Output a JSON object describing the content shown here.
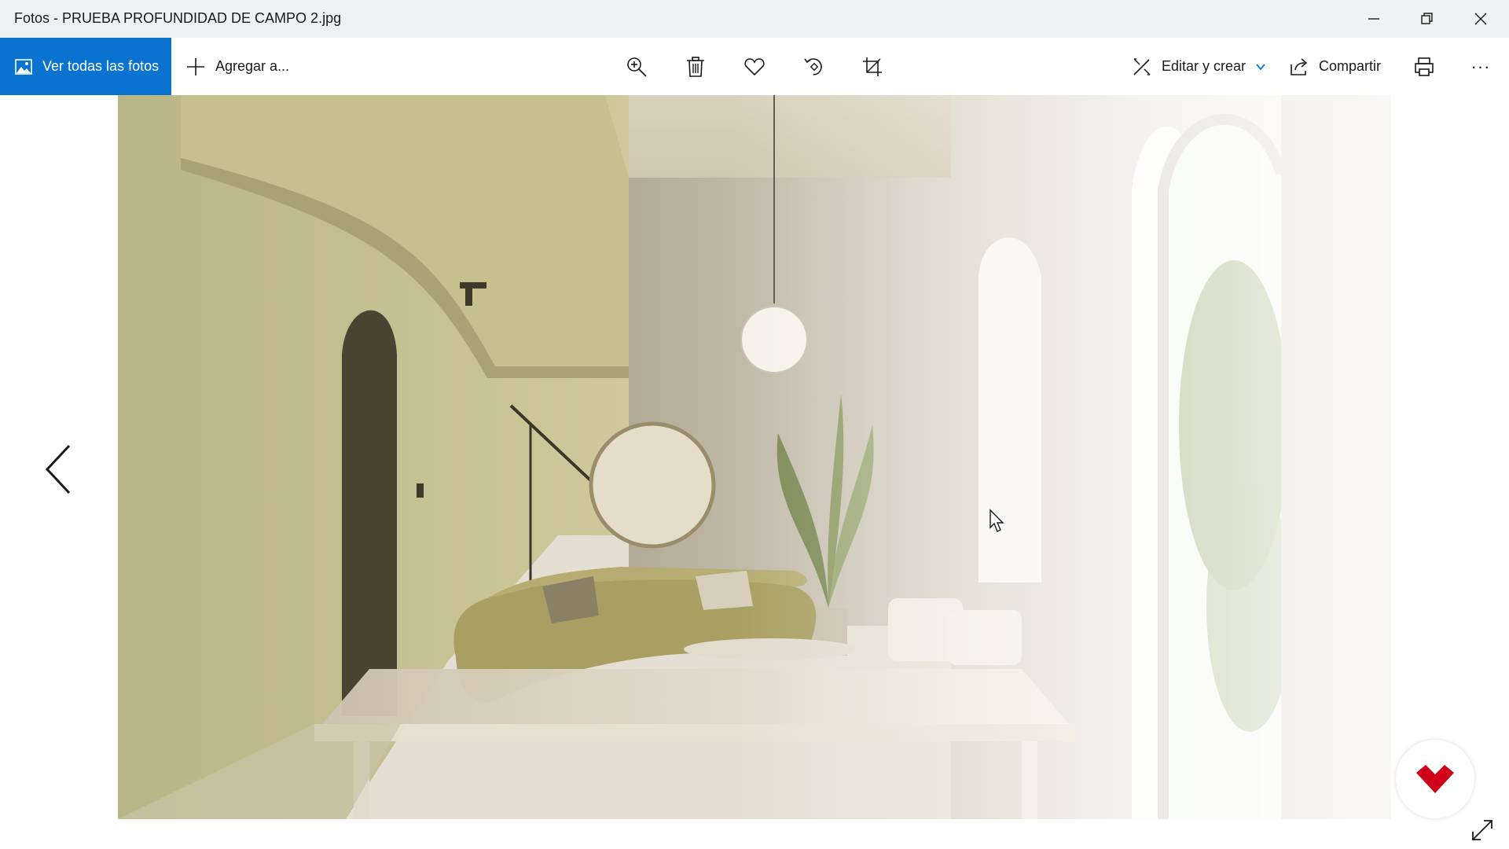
{
  "window": {
    "title": "Fotos - PRUEBA PROFUNDIDAD DE CAMPO 2.jpg",
    "controls": [
      "minimize-icon",
      "restore-icon",
      "close-icon"
    ]
  },
  "toolbar": {
    "see_all_label": "Ver todas las fotos",
    "add_to_label": "Agregar a...",
    "tools": [
      "zoom-in-icon",
      "delete-icon",
      "favorite-icon",
      "rotate-icon",
      "crop-icon"
    ],
    "edit_create_label": "Editar y crear",
    "share_label": "Compartir",
    "print_icon": "print-icon",
    "more_label": "···",
    "accent_color": "#0a73d0"
  },
  "viewer": {
    "prev_icon": "chevron-left-icon",
    "badge_icon": "logo-icon",
    "badge_color": "#d0021b",
    "expand_icon": "expand-icon"
  }
}
